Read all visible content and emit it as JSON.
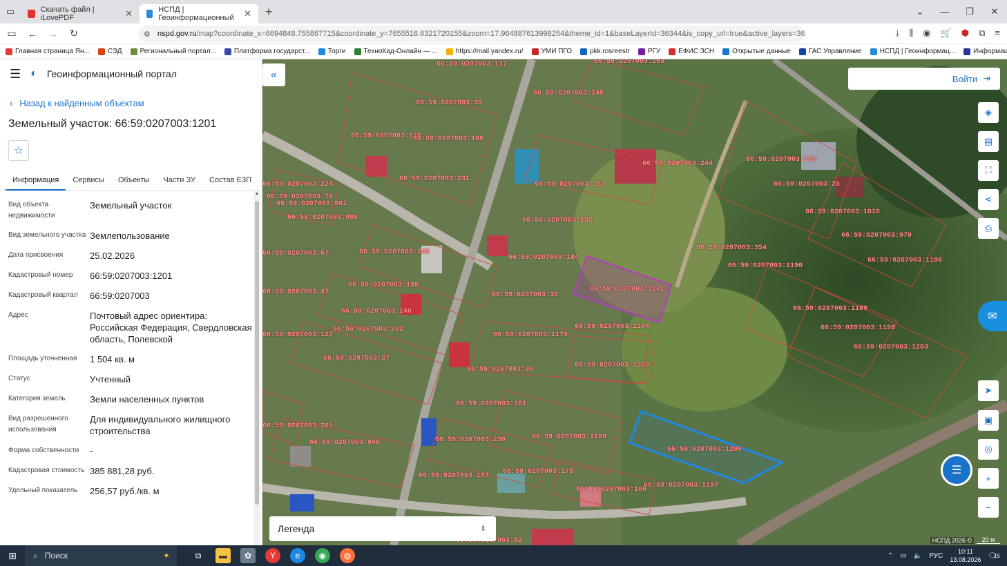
{
  "browser": {
    "tabs": [
      {
        "title": "Скачать файл | iLovePDF",
        "color": "#e5322d",
        "active": false
      },
      {
        "title": "НСПД | Геоинформационный",
        "color": "#2a8ad8",
        "active": true
      }
    ],
    "url_domain": "nspd.gov.ru",
    "url_rest": "/map?coordinate_x=6694848.755867715&coordinate_y=7655516.6321720155&zoom=17.964887613998254&theme_id=1&baseLayerId=36344&is_copy_url=true&active_layers=360",
    "bookmarks": [
      {
        "label": "Главная страница Ян...",
        "color": "#e53935"
      },
      {
        "label": "СЭД",
        "color": "#d84315"
      },
      {
        "label": "Региональный портал...",
        "color": "#6d8f3a"
      },
      {
        "label": "Платформа государст...",
        "color": "#3949ab"
      },
      {
        "label": "Торги",
        "color": "#1e88e5"
      },
      {
        "label": "ТехноКад-Онлайн — ...",
        "color": "#2e7d32"
      },
      {
        "label": "https://mail.yandex.ru/",
        "color": "#f4b400"
      },
      {
        "label": "УМИ ПГО",
        "color": "#c62828"
      },
      {
        "label": "pkk.rosreestr",
        "color": "#1565c0"
      },
      {
        "label": "РГУ",
        "color": "#7b1fa2"
      },
      {
        "label": "ЕФИС ЗСН",
        "color": "#d32f2f"
      },
      {
        "label": "Открытые данные",
        "color": "#1976d2"
      },
      {
        "label": "ГАС Управление",
        "color": "#0d47a1"
      },
      {
        "label": "НСПД | Геоинформац...",
        "color": "#2a8ad8"
      },
      {
        "label": "Информация о граж...",
        "color": "#283593"
      }
    ]
  },
  "panel": {
    "portal_title": "Геоинформационный портал",
    "back_label": "Назад к найденным объектам",
    "object_title": "Земельный участок: 66:59:0207003:1201",
    "tabs": [
      "Информация",
      "Сервисы",
      "Объекты",
      "Части ЗУ",
      "Состав ЕЗП"
    ],
    "rows": [
      {
        "key": "Вид объекта недвижимости",
        "value": "Земельный участок"
      },
      {
        "key": "Вид земельного участка",
        "value": "Землепользование"
      },
      {
        "key": "Дата присвоения",
        "value": "25.02.2026"
      },
      {
        "key": "Кадастровый номер",
        "value": "66:59:0207003:1201"
      },
      {
        "key": "Кадастровый квартал",
        "value": "66:59:0207003"
      },
      {
        "key": "Адрес",
        "value": "Почтовый адрес ориентира: Российская Федерация, Свердловская область, Полевской"
      },
      {
        "key": "Площадь уточненная",
        "value": "1 504 кв. м"
      },
      {
        "key": "Статус",
        "value": "Учтенный"
      },
      {
        "key": "Категория земель",
        "value": "Земли населенных пунктов"
      },
      {
        "key": "Вид разрешенного использования",
        "value": "Для индивидуального жилищного строительства"
      },
      {
        "key": "Форма собственности",
        "value": "-"
      },
      {
        "key": "Кадастровая стоимость",
        "value": "385 881,28 руб."
      },
      {
        "key": "Удельный показатель",
        "value": "256,57 руб./кв. м"
      }
    ]
  },
  "map": {
    "login_label": "Войти",
    "legend_label": "Легенда",
    "copyright": "НСПД 2026 ©",
    "scale": "20 м",
    "labels": [
      "66:59:0207003:177",
      "66:59:0207003:263",
      "66:59:0207003:245",
      "66:59:0207003:39",
      "66:59:0207003:126",
      "66:59:0207003:186",
      "66:59:0207003:244",
      "66:59:0207003:133",
      "66:59:0207003:231",
      "66:59:0207003:157",
      "66:59:0207003:25",
      "66:59:0207003:224",
      "66:59:0207003:70",
      "66:59:0207003:981",
      "66:59:0207003:980",
      "66:59:0207003:192",
      "66:59:0207003:1010",
      "66:59:0207003:970",
      "66:59:0207003:354",
      "66:59:0207003:249",
      "66:59:0207003:67",
      "66:59:0207003:184",
      "66:59:0207003:1190",
      "66:59:0207003:1186",
      "66:59:0207003:185",
      "66:59:0207003:1201",
      "66:59:0207003:47",
      "66:59:0207003:35",
      "66:59:0207003:240",
      "66:59:0207003:1189",
      "66:59:0207003:1194",
      "66:59:0207003:1198",
      "66:59:0207003:202",
      "66:59:0207003:1179",
      "66:59:0207003:127",
      "66:59:0207003:1203",
      "66:59:0207003:37",
      "66:59:0207003:36",
      "66:59:0207003:1209",
      "66:59:0207003:181",
      "66:59:0207003:265",
      "66:59:0207003:1199",
      "66:59:0207003:230",
      "66:59:0207003:940",
      "66:59:0207003:1200",
      "66:59:0207003:197",
      "66:59:0207003:175",
      "66:59:0207003:100",
      "66:59:0207003:1197",
      "66:59:0207003:52"
    ]
  },
  "taskbar": {
    "search_label": "Поиск",
    "lang": "РУС",
    "time": "10:11",
    "date": "13.08.2026",
    "notif": "15"
  }
}
